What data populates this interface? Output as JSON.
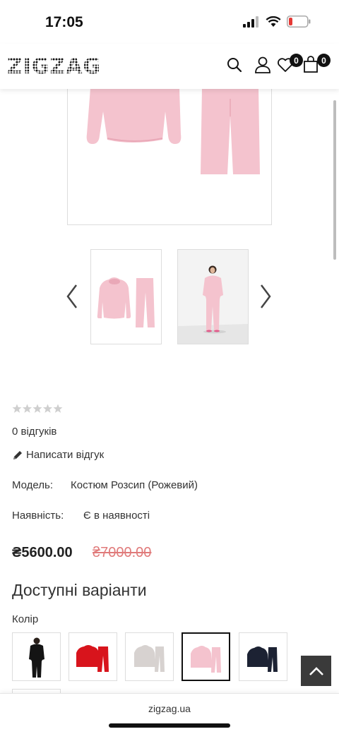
{
  "status_bar": {
    "time": "17:05"
  },
  "header": {
    "logo_text": "ZIGZAG",
    "wishlist_count": "0",
    "cart_count": "0"
  },
  "product": {
    "rating_stars": 0,
    "reviews_text": "0 відгуків",
    "write_review_text": "Написати відгук",
    "model_label": "Модель:",
    "model_value": "Костюм Розсип (Рожевий)",
    "availability_label": "Наявність:",
    "availability_value": "Є в наявності",
    "price": "₴5600.00",
    "old_price": "₴7000.00",
    "variants_title": "Доступні варіанти",
    "color_label": "Колір"
  },
  "colors": {
    "pink": "#f4c3ce",
    "pink_dark": "#e9a8b7",
    "red": "#d8141c",
    "grey": "#d7d2d0",
    "navy": "#1c2233",
    "black": "#141414"
  },
  "browser": {
    "url": "zigzag.ua"
  }
}
